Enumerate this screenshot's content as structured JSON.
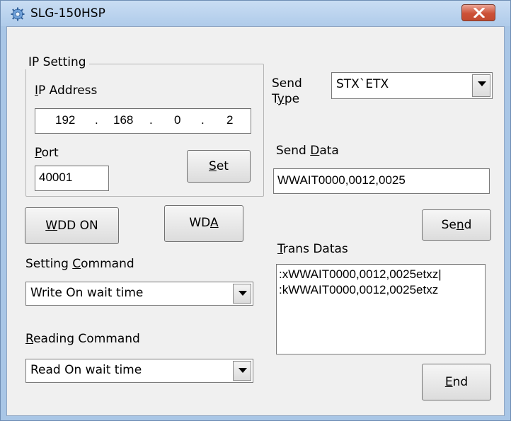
{
  "window": {
    "title": "SLG-150HSP",
    "app_icon": "gear-icon",
    "close_icon": "close-icon"
  },
  "ip_setting": {
    "group_label": "IP Setting",
    "ip_address_label": "IP Address",
    "ip_octets": [
      "192",
      "168",
      "0",
      "2"
    ],
    "port_label": "Port",
    "port_value": "40001",
    "set_button": "Set"
  },
  "buttons": {
    "wdd_on": "WDD ON",
    "wda": "WDA",
    "send": "Send",
    "end": "End"
  },
  "setting_command": {
    "label": "Setting Command",
    "selected": "Write On wait time"
  },
  "reading_command": {
    "label": "Reading Command",
    "selected": "Read On wait time"
  },
  "send_type": {
    "label_line1": "Send",
    "label_line2": "Type",
    "selected": "STX`ETX"
  },
  "send_data": {
    "label": "Send Data",
    "value": "WWAIT0000,0012,0025"
  },
  "trans_datas": {
    "label": "Trans Datas",
    "lines": [
      ":xWWAIT0000,0012,0025etxz|",
      ":kWWAIT0000,0012,0025etxz"
    ]
  },
  "colors": {
    "frame": "#a9c6e6",
    "client_bg": "#f0f0f0",
    "close_button": "#cc5137"
  }
}
